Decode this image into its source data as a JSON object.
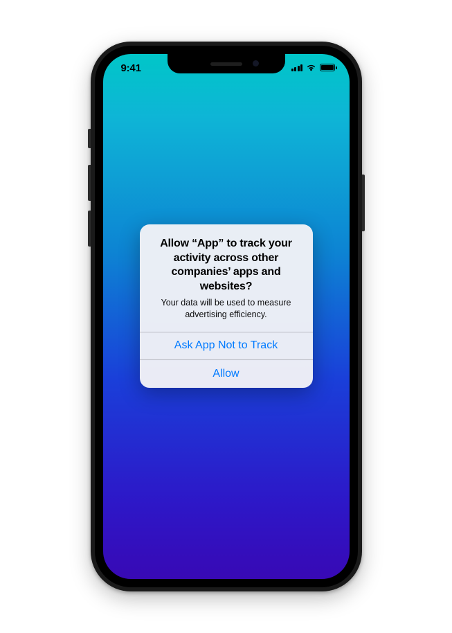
{
  "status_bar": {
    "time": "9:41"
  },
  "alert": {
    "title": "Allow “App” to track your activity across other companies’ apps and websites?",
    "message": "Your data will be used to measure advertising efficiency.",
    "deny_label": "Ask App Not to Track",
    "allow_label": "Allow"
  }
}
